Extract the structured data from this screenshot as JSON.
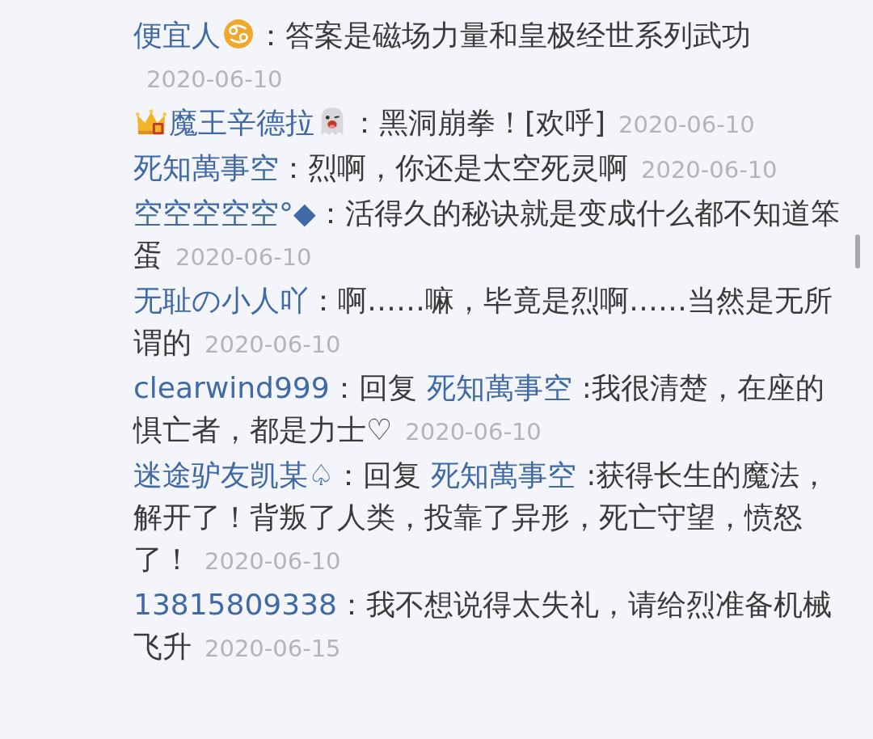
{
  "comments": [
    {
      "author": "便宜人",
      "suffix": {
        "kind": "cancer"
      },
      "text": "答案是磁场力量和皇极经世系列武功",
      "date": "2020-06-10"
    },
    {
      "author": "魔王辛德拉",
      "prefix": {
        "kind": "crown"
      },
      "suffix": {
        "kind": "ghost"
      },
      "text": "黑洞崩拳！[欢呼]",
      "date": "2020-06-10"
    },
    {
      "author": "死知萬事空",
      "text": "烈啊，你还是太空死灵啊",
      "date": "2020-06-10"
    },
    {
      "author": "空空空空空°◆",
      "text": "活得久的秘诀就是变成什么都不知道笨蛋",
      "date": "2020-06-10"
    },
    {
      "author": "无耻の小人吖",
      "text": "啊……嘛，毕竟是烈啊……当然是无所谓的",
      "date": "2020-06-10"
    },
    {
      "author": "clearwind999",
      "reply": {
        "label": "回复",
        "to": "死知萬事空"
      },
      "text": ":我很清楚，在座的惧亡者，都是力士♡",
      "date": "2020-06-10"
    },
    {
      "author": "迷途驴友凯某♤",
      "reply": {
        "label": "回复",
        "to": "死知萬事空"
      },
      "text": ":获得长生的魔法，解开了！背叛了人类，投靠了异形，死亡守望，愤怒了！",
      "date": "2020-06-10"
    },
    {
      "author": "13815809338",
      "text": "我不想说得太失礼，请给烈准备机械飞升",
      "date": "2020-06-15"
    }
  ],
  "separator": "："
}
